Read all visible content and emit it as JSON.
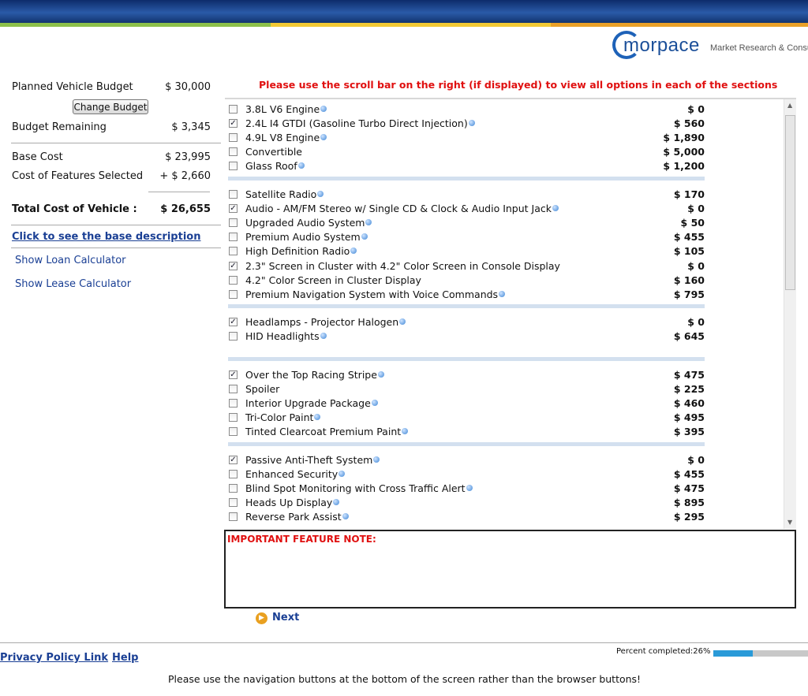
{
  "brand": {
    "logo_text": "morpace",
    "tagline": "Market Research & Consulting"
  },
  "sidebar": {
    "planned_label": "Planned Vehicle Budget",
    "planned_value": "$ 30,000",
    "change_budget": "Change Budget",
    "remaining_label": "Budget Remaining",
    "remaining_value": "$ 3,345",
    "base_label": "Base Cost",
    "base_value": "$ 23,995",
    "features_label": "Cost of Features Selected",
    "features_value": "+ $ 2,660",
    "total_label": "Total Cost of Vehicle :",
    "total_value": "$ 26,655",
    "base_desc_link": "Click to see the base description",
    "loan_link": "Show Loan Calculator",
    "lease_link": "Show Lease Calculator"
  },
  "notice": "Please use the scroll bar on the right (if displayed) to view all options in each of the sections",
  "groups": [
    {
      "items": [
        {
          "label": "3.8L V6 Engine",
          "price": "$ 0",
          "checked": false,
          "info": true
        },
        {
          "label": "2.4L I4 GTDI (Gasoline Turbo Direct Injection)",
          "price": "$ 560",
          "checked": true,
          "info": true
        },
        {
          "label": "4.9L V8 Engine",
          "price": "$ 1,890",
          "checked": false,
          "info": true
        },
        {
          "label": "Convertible",
          "price": "$ 5,000",
          "checked": false,
          "info": false
        },
        {
          "label": "Glass Roof",
          "price": "$ 1,200",
          "checked": false,
          "info": true
        }
      ]
    },
    {
      "items": [
        {
          "label": "Satellite Radio",
          "price": "$ 170",
          "checked": false,
          "info": true
        },
        {
          "label": "Audio - AM/FM Stereo w/ Single CD & Clock & Audio Input Jack",
          "price": "$ 0",
          "checked": true,
          "info": true
        },
        {
          "label": "Upgraded Audio System",
          "price": "$ 50",
          "checked": false,
          "info": true
        },
        {
          "label": "Premium Audio System",
          "price": "$ 455",
          "checked": false,
          "info": true
        },
        {
          "label": "High Definition Radio",
          "price": "$ 105",
          "checked": false,
          "info": true
        },
        {
          "label": "2.3\" Screen in Cluster with 4.2\" Color Screen in Console Display",
          "price": "$ 0",
          "checked": true,
          "info": false
        },
        {
          "label": "4.2\" Color Screen in Cluster Display",
          "price": "$ 160",
          "checked": false,
          "info": false
        },
        {
          "label": "Premium Navigation System with Voice Commands",
          "price": "$ 795",
          "checked": false,
          "info": true
        }
      ]
    },
    {
      "items": [
        {
          "label": "Headlamps - Projector Halogen",
          "price": "$ 0",
          "checked": true,
          "info": true
        },
        {
          "label": "HID Headlights",
          "price": "$ 645",
          "checked": false,
          "info": true
        }
      ]
    },
    {
      "items": [
        {
          "label": "Over the Top Racing Stripe",
          "price": "$ 475",
          "checked": true,
          "info": true
        },
        {
          "label": "Spoiler",
          "price": "$ 225",
          "checked": false,
          "info": false
        },
        {
          "label": "Interior Upgrade Package",
          "price": "$ 460",
          "checked": false,
          "info": true
        },
        {
          "label": "Tri-Color Paint",
          "price": "$ 495",
          "checked": false,
          "info": true
        },
        {
          "label": "Tinted Clearcoat Premium Paint",
          "price": "$ 395",
          "checked": false,
          "info": true
        }
      ]
    },
    {
      "items": [
        {
          "label": "Passive Anti-Theft System",
          "price": "$ 0",
          "checked": true,
          "info": true
        },
        {
          "label": "Enhanced Security",
          "price": "$ 455",
          "checked": false,
          "info": true
        },
        {
          "label": "Blind Spot Monitoring with Cross Traffic Alert",
          "price": "$ 475",
          "checked": false,
          "info": true
        },
        {
          "label": "Heads Up Display",
          "price": "$ 895",
          "checked": false,
          "info": true
        },
        {
          "label": "Reverse Park Assist",
          "price": "$ 295",
          "checked": false,
          "info": true
        }
      ]
    }
  ],
  "feature_note_title": "IMPORTANT FEATURE NOTE:",
  "next_label": "Next",
  "footer": {
    "privacy": "Privacy Policy Link",
    "help": "Help",
    "percent_label": "Percent completed:26%",
    "percent": 26,
    "bottom_message": "Please use the navigation buttons at the bottom of the screen rather than the browser buttons!"
  },
  "colors": {
    "accent": "#1a3f94",
    "warning": "#e01010",
    "progress": "#2a9ad8"
  }
}
